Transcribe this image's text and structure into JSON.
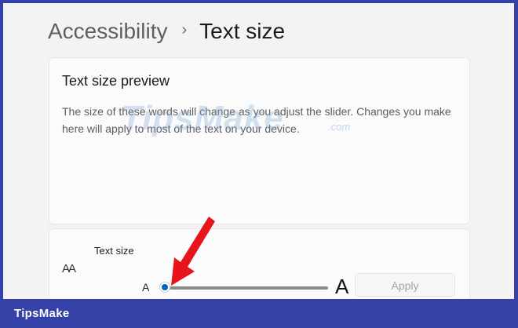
{
  "breadcrumb": {
    "parent": "Accessibility",
    "separator": "›",
    "current": "Text size"
  },
  "preview": {
    "title": "Text size preview",
    "description": "The size of these words will change as you adjust the slider. Changes you make here will apply to most of the text on your device."
  },
  "watermark": {
    "main": "TipsMake",
    "sub": ".com"
  },
  "text_size": {
    "icon": "text-size-icon",
    "icon_glyph": "AA",
    "label": "Text size",
    "min_label": "A",
    "max_label": "A",
    "slider_value": 0,
    "apply_label": "Apply"
  },
  "footer": {
    "brand": "TipsMake"
  },
  "colors": {
    "frame_border": "#3441a7",
    "accent": "#0067c0",
    "annotation_arrow": "#e8141b"
  }
}
